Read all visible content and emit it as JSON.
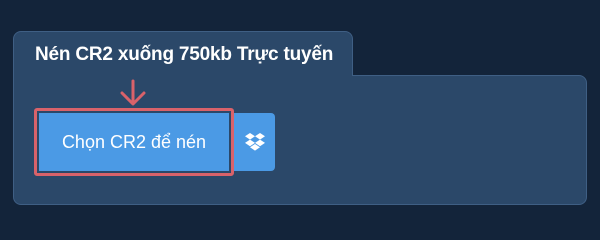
{
  "converter": {
    "title": "Nén CR2 xuống 750kb Trực tuyến",
    "choose_button_label": "Chọn CR2 để nén",
    "dropbox_icon": "dropbox-icon",
    "pointer_icon": "down-arrow-icon"
  },
  "colors": {
    "page_background": "#13243a",
    "panel_background": "#2b4869",
    "button_background": "#4b9ae5",
    "highlight_border": "#d9626a"
  }
}
